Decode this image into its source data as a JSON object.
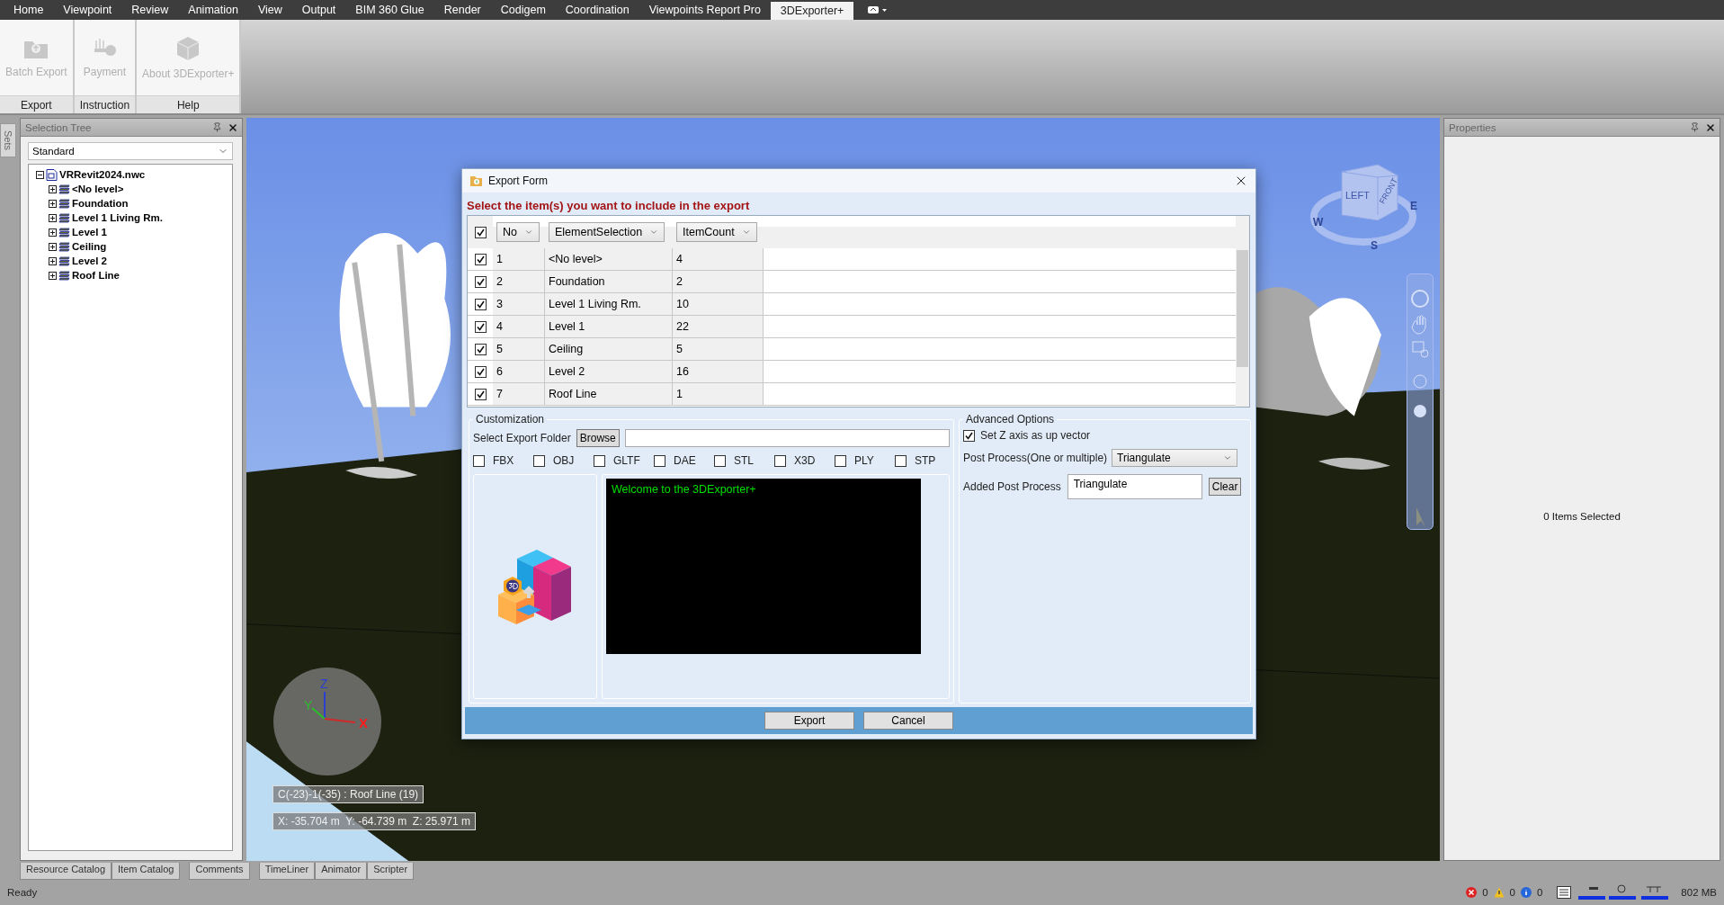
{
  "menu_tabs": [
    {
      "label": "Home",
      "selected": false
    },
    {
      "label": "Viewpoint",
      "selected": false
    },
    {
      "label": "Review",
      "selected": false
    },
    {
      "label": "Animation",
      "selected": false
    },
    {
      "label": "View",
      "selected": false
    },
    {
      "label": "Output",
      "selected": false
    },
    {
      "label": "BIM 360 Glue",
      "selected": false
    },
    {
      "label": "Render",
      "selected": false
    },
    {
      "label": "Codigem",
      "selected": false
    },
    {
      "label": "Coordination",
      "selected": false
    },
    {
      "label": "Viewpoints Report Pro",
      "selected": false
    },
    {
      "label": "3DExporter+",
      "selected": true
    }
  ],
  "ribbon": {
    "groups": [
      {
        "label": "Export",
        "button": {
          "label": "Batch Export",
          "kind": "export",
          "disabled": true
        }
      },
      {
        "label": "Instruction",
        "button": {
          "label": "Payment",
          "kind": "key",
          "disabled": true
        }
      },
      {
        "label": "Help",
        "button": {
          "label": "About 3DExporter+",
          "kind": "box",
          "disabled": true
        }
      }
    ]
  },
  "sets_tab": "Sets",
  "selection_tree": {
    "title": "Selection Tree",
    "mode": "Standard",
    "root": {
      "label": "VRRevit2024.nwc",
      "expanded": true,
      "children": [
        {
          "label": "<No level>",
          "expanded": false
        },
        {
          "label": "Foundation",
          "expanded": false
        },
        {
          "label": "Level 1 Living Rm.",
          "expanded": false
        },
        {
          "label": "Level 1",
          "expanded": false
        },
        {
          "label": "Ceiling",
          "expanded": false
        },
        {
          "label": "Level 2",
          "expanded": false
        },
        {
          "label": "Roof Line",
          "expanded": false
        }
      ]
    }
  },
  "viewport": {
    "viewcube": {
      "faces": [
        "LEFT",
        "FRONT"
      ],
      "compass": [
        "W",
        "S",
        "E"
      ]
    },
    "axes": [
      "Z",
      "Y",
      "X"
    ],
    "hover_label": "C(-23)-1(-35) : Roof Line (19)",
    "coordinates": "X: -35.704 m  Y: -64.739 m  Z: 25.971 m"
  },
  "dialog": {
    "title": "Export Form",
    "heading": "Select the item(s) you want to include in the export",
    "grid": {
      "all_checked": true,
      "columns": [
        "No",
        "ElementSelection",
        "ItemCount"
      ],
      "rows": [
        {
          "checked": true,
          "cells": [
            "1",
            "<No level>",
            "4"
          ]
        },
        {
          "checked": true,
          "cells": [
            "2",
            "Foundation",
            "2"
          ]
        },
        {
          "checked": true,
          "cells": [
            "3",
            "Level 1 Living Rm.",
            "10"
          ]
        },
        {
          "checked": true,
          "cells": [
            "4",
            "Level 1",
            "22"
          ]
        },
        {
          "checked": true,
          "cells": [
            "5",
            "Ceiling",
            "5"
          ]
        },
        {
          "checked": true,
          "cells": [
            "6",
            "Level 2",
            "16"
          ]
        },
        {
          "checked": true,
          "cells": [
            "7",
            "Roof Line",
            "1"
          ]
        }
      ]
    },
    "customization": {
      "title": "Customization",
      "folder_label": "Select Export Folder",
      "browse": "Browse",
      "formats": [
        {
          "label": "FBX",
          "checked": false
        },
        {
          "label": "OBJ",
          "checked": false
        },
        {
          "label": "GLTF",
          "checked": false
        },
        {
          "label": "DAE",
          "checked": false
        },
        {
          "label": "STL",
          "checked": false
        },
        {
          "label": "X3D",
          "checked": false
        },
        {
          "label": "PLY",
          "checked": false
        },
        {
          "label": "STP",
          "checked": false
        }
      ],
      "log": "Welcome to the 3DExporter+"
    },
    "advanced": {
      "title": "Advanced Options",
      "z_up": {
        "label": "Set Z axis as up vector",
        "checked": true
      },
      "post_process_label": "Post Process(One or multiple)",
      "post_process_value": "Triangulate",
      "added_label": "Added Post Process",
      "added_value": "Triangulate",
      "clear": "Clear"
    },
    "buttons": [
      "Export",
      "Cancel"
    ]
  },
  "properties": {
    "title": "Properties",
    "message": "0 Items Selected"
  },
  "bottom_tabs": [
    {
      "tabs": [
        "Resource Catalog",
        "Item Catalog"
      ]
    },
    {
      "tabs": [
        "Comments"
      ]
    },
    {
      "tabs": [
        "TimeLiner",
        "Animator",
        "Scripter"
      ]
    }
  ],
  "status_bar": {
    "text": "Ready",
    "errors": "0",
    "warnings": "0",
    "infos": "0",
    "memory": "802 MB"
  }
}
